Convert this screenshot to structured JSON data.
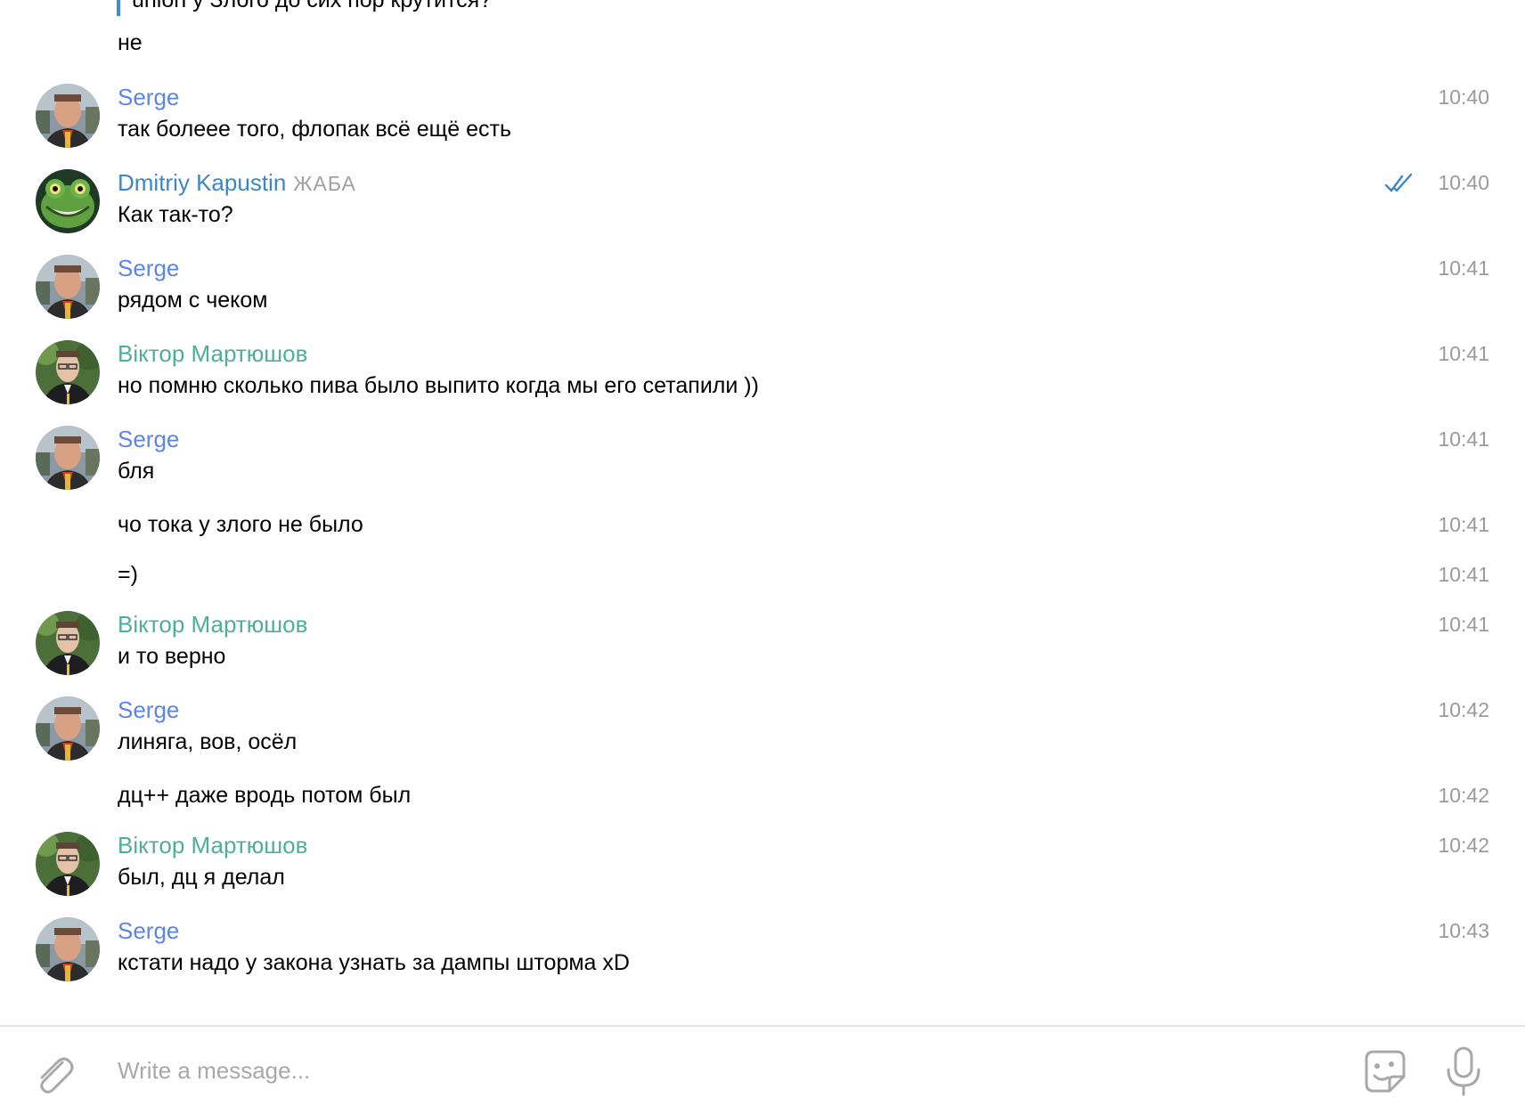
{
  "colors": {
    "serge": "#5b86e5",
    "dmitriy": "#3d86c6",
    "viktor": "#4fae9a",
    "time": "#9a9a9a",
    "ticks": "#3d86c6"
  },
  "quote": {
    "text": "union у Злого до сих пор крутится?"
  },
  "messages": [
    {
      "text": "не"
    },
    {
      "sender": "Serge",
      "text": "так болеее того, флопак всё ещё есть",
      "time": "10:40"
    },
    {
      "sender": "Dmitriy Kapustin",
      "title": "ЖАБА",
      "text": "Как так-то?",
      "time": "10:40",
      "read": true
    },
    {
      "sender": "Serge",
      "text": "рядом с чеком",
      "time": "10:41"
    },
    {
      "sender": "Віктор Мартюшов",
      "text": "но помню сколько пива было выпито когда мы его сетапили ))",
      "time": "10:41"
    },
    {
      "sender": "Serge",
      "text": "бля",
      "time": "10:41"
    },
    {
      "text": "чо тока у злого не было",
      "time": "10:41"
    },
    {
      "text": "=)",
      "time": "10:41"
    },
    {
      "sender": "Віктор Мартюшов",
      "text": "и то верно",
      "time": "10:41"
    },
    {
      "sender": "Serge",
      "text": "линяга, вов, осёл",
      "time": "10:42"
    },
    {
      "text": "дц++ даже вродь потом был",
      "time": "10:42"
    },
    {
      "sender": "Віктор Мартюшов",
      "text": "был, дц я делал",
      "time": "10:42"
    },
    {
      "sender": "Serge",
      "text": "кстати надо у закона узнать за дампы шторма xD",
      "time": "10:43"
    }
  ],
  "composer": {
    "placeholder": "Write a message...",
    "attach_icon": "paperclip-icon",
    "sticker_icon": "sticker-icon",
    "mic_icon": "microphone-icon"
  }
}
